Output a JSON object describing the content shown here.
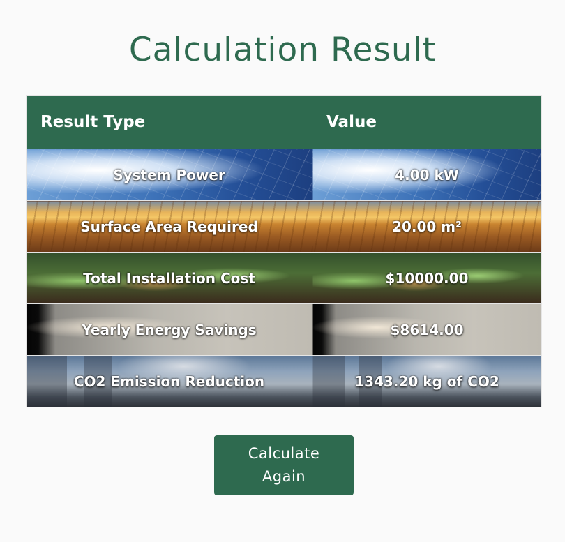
{
  "page": {
    "title": "Calculation Result"
  },
  "table": {
    "headers": [
      "Result Type",
      "Value"
    ],
    "rows": [
      {
        "type": "System Power",
        "value": "4.00 kW",
        "background": "solar-panel-photo"
      },
      {
        "type": "Surface Area Required",
        "value": "20.00 m²",
        "background": "field-photo"
      },
      {
        "type": "Total Installation Cost",
        "value": "$10000.00",
        "background": "plants-coins-photo"
      },
      {
        "type": "Yearly Energy Savings",
        "value": "$8614.00",
        "background": "light-bulb-photo"
      },
      {
        "type": "CO2 Emission Reduction",
        "value": "1343.20 kg of CO2",
        "background": "power-plant-photo"
      }
    ]
  },
  "actions": {
    "calculate_again_label": "Calculate Again"
  },
  "colors": {
    "accent": "#2e6a4f",
    "background": "#fafafa"
  }
}
